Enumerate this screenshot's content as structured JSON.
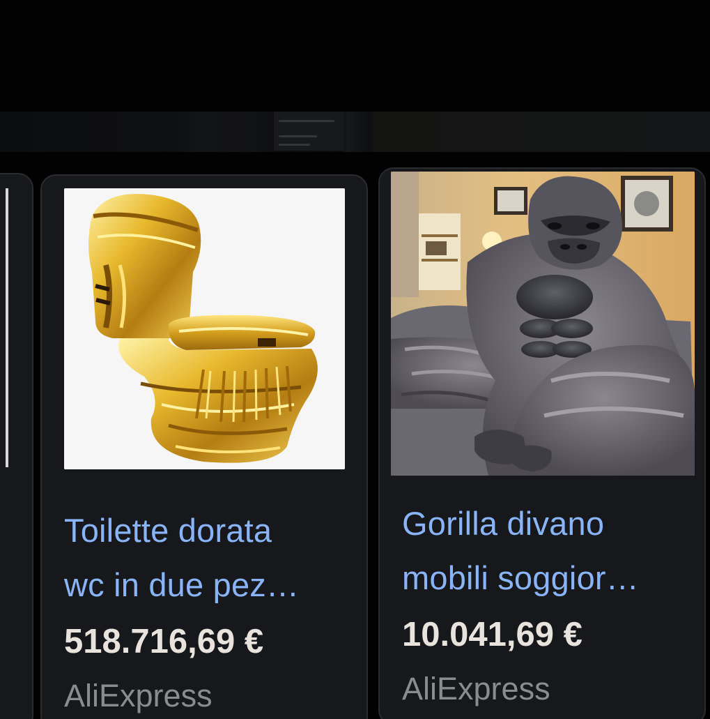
{
  "products": [
    {
      "image_icon": "golden-toilet-image",
      "title_line1": "Toilette dorata",
      "title_line2": "wc in due pez…",
      "price": "518.716,69 €",
      "merchant": "AliExpress"
    },
    {
      "image_icon": "gorilla-sofa-image",
      "title_line1": "Gorilla divano",
      "title_line2": "mobili soggior…",
      "price": "10.041,69 €",
      "merchant": "AliExpress"
    }
  ],
  "colors": {
    "background": "#020203",
    "card": "#17181b",
    "title_link": "#8ab4f8",
    "price": "#e8e3dc",
    "merchant": "#8a8c90"
  }
}
